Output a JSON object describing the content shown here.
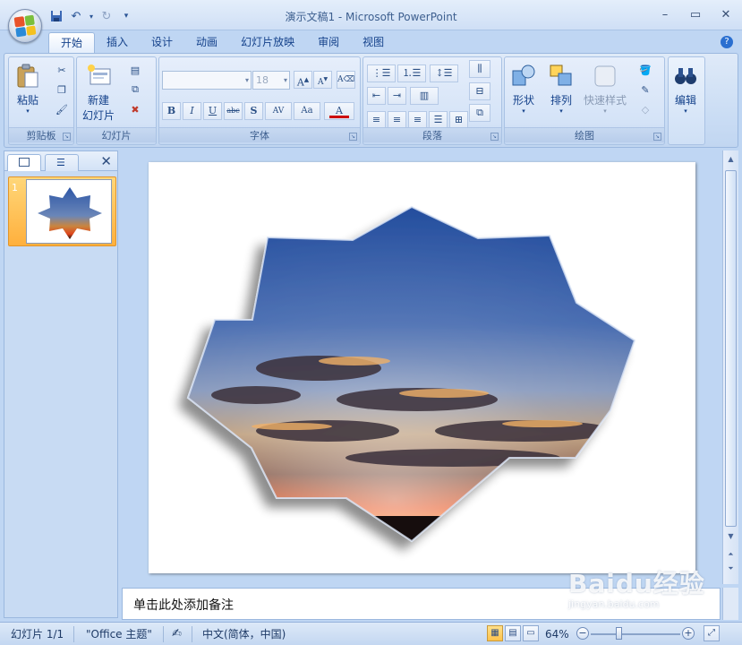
{
  "window": {
    "title": "演示文稿1 - Microsoft PowerPoint"
  },
  "tabs": [
    "开始",
    "插入",
    "设计",
    "动画",
    "幻灯片放映",
    "审阅",
    "视图"
  ],
  "ribbon": {
    "clipboard": {
      "paste_label": "粘贴",
      "group_label": "剪贴板"
    },
    "slides": {
      "new_slide_line1": "新建",
      "new_slide_line2": "幻灯片",
      "group_label": "幻灯片"
    },
    "font": {
      "font_name_value": "",
      "font_size_value": "18",
      "group_label": "字体"
    },
    "paragraph": {
      "group_label": "段落"
    },
    "drawing": {
      "shapes_label": "形状",
      "arrange_label": "排列",
      "quick_styles_label": "快速样式",
      "group_label": "绘图"
    },
    "editing": {
      "label": "编辑"
    }
  },
  "slides_panel": {
    "thumbnail_number": "1"
  },
  "notes": {
    "placeholder": "单击此处添加备注"
  },
  "status_bar": {
    "slide_info": "幻灯片 1/1",
    "theme": "\"Office 主题\"",
    "language": "中文(简体，中国)",
    "zoom": "64%"
  },
  "watermark": {
    "text": "Baidu经验",
    "sub": "jingyan.baidu.com"
  },
  "colors": {
    "ribbon_bg": "#c9dcf4",
    "accent": "#15428b",
    "selection": "#ffb03d"
  }
}
